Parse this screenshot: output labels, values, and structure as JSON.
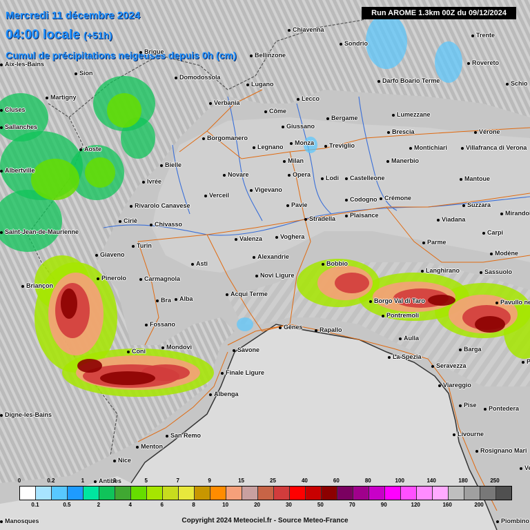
{
  "header": {
    "date_line": "Mercredi 11 décembre 2024",
    "time_line": "04:00 locale",
    "time_offset": "(+51h)",
    "product_line": "Cumul de précipitations neigeuses depuis 0h (cm)"
  },
  "run_label": "Run AROME 1.3km 00Z du 09/12/2024",
  "copyright": "Copyright 2024 Meteociel.fr - Source Meteo-France",
  "colors": {
    "sea": "#d6d6d6",
    "land": "#c4c4c4",
    "roads": "#e06a10",
    "rivers": "#3a6fd8",
    "borders": "#444444",
    "header_text": "#1e90ff"
  },
  "legend": {
    "top_labels": [
      "0",
      "0.2",
      "1",
      "3",
      "5",
      "7",
      "9",
      "15",
      "25",
      "40",
      "60",
      "80",
      "100",
      "140",
      "180",
      "250"
    ],
    "bottom_labels": [
      "0.1",
      "0.5",
      "2",
      "4",
      "6",
      "8",
      "10",
      "20",
      "30",
      "50",
      "70",
      "90",
      "120",
      "160",
      "200"
    ],
    "colors": [
      "#ffffff",
      "#a8e4ff",
      "#58c8ff",
      "#1e9bff",
      "#00e6a0",
      "#10c45a",
      "#40a832",
      "#66dd00",
      "#a6e600",
      "#c8dc1e",
      "#e8e83c",
      "#c89600",
      "#ff8c00",
      "#f5a07a",
      "#c8a0a0",
      "#c86446",
      "#d23c3c",
      "#ff0000",
      "#c80000",
      "#8c0000",
      "#7a0060",
      "#a0008c",
      "#c800c8",
      "#ff00ff",
      "#ff50ff",
      "#ff8cff",
      "#ffaaff",
      "#bebebe",
      "#a0a0a0",
      "#787878",
      "#505050"
    ]
  },
  "cities": [
    {
      "name": "Chiavenna"
    },
    {
      "name": "Sondrio"
    },
    {
      "name": "Trente"
    },
    {
      "name": "Brigue"
    },
    {
      "name": "Bellinzone"
    },
    {
      "name": "Rovereto"
    },
    {
      "name": "Sion"
    },
    {
      "name": "Domodossola"
    },
    {
      "name": "Lugano"
    },
    {
      "name": "Darfo Boario Terme"
    },
    {
      "name": "Schio"
    },
    {
      "name": "Martigny"
    },
    {
      "name": "Verbania"
    },
    {
      "name": "Côme"
    },
    {
      "name": "Lecco"
    },
    {
      "name": "Lumezzane"
    },
    {
      "name": "Cluses"
    },
    {
      "name": "Bergame"
    },
    {
      "name": "Giussano"
    },
    {
      "name": "Sallanches"
    },
    {
      "name": "Brescia"
    },
    {
      "name": "Vérone"
    },
    {
      "name": "Borgomanero"
    },
    {
      "name": "Legnano"
    },
    {
      "name": "Monza"
    },
    {
      "name": "Treviglio"
    },
    {
      "name": "Montichiari"
    },
    {
      "name": "Villafranca di Verona"
    },
    {
      "name": "Aoste"
    },
    {
      "name": "Milan"
    },
    {
      "name": "Manerbio"
    },
    {
      "name": "Bielle"
    },
    {
      "name": "Novare"
    },
    {
      "name": "Opera"
    },
    {
      "name": "Lodi"
    },
    {
      "name": "Castelleone"
    },
    {
      "name": "Mantoue"
    },
    {
      "name": "Ivrée"
    },
    {
      "name": "Vigevano"
    },
    {
      "name": "Crémone"
    },
    {
      "name": "Verceil"
    },
    {
      "name": "Codogno"
    },
    {
      "name": "Rivarolo Canavese"
    },
    {
      "name": "Pavie"
    },
    {
      "name": "Suzzara"
    },
    {
      "name": "Plaisance"
    },
    {
      "name": "Mirandola"
    },
    {
      "name": "Ciriè"
    },
    {
      "name": "Stradella"
    },
    {
      "name": "Chivasso"
    },
    {
      "name": "Viadana"
    },
    {
      "name": "Saint-Jean-de-Maurienne"
    },
    {
      "name": "Carpi"
    },
    {
      "name": "Voghera"
    },
    {
      "name": "Valenza"
    },
    {
      "name": "Turin"
    },
    {
      "name": "Parme"
    },
    {
      "name": "Giaveno"
    },
    {
      "name": "Alexandrie"
    },
    {
      "name": "Modène"
    },
    {
      "name": "Asti"
    },
    {
      "name": "Bobbio"
    },
    {
      "name": "Langhirano"
    },
    {
      "name": "Sassuolo"
    },
    {
      "name": "Novi Ligure"
    },
    {
      "name": "Pinerolo"
    },
    {
      "name": "Carmagnola"
    },
    {
      "name": "Briançon"
    },
    {
      "name": "Acqui Terme"
    },
    {
      "name": "Borgo Val di Taro"
    },
    {
      "name": "Pavullo nel"
    },
    {
      "name": "Bra"
    },
    {
      "name": "Alba"
    },
    {
      "name": "Pontremoli"
    },
    {
      "name": "Fossano"
    },
    {
      "name": "Gênes"
    },
    {
      "name": "Rapallo"
    },
    {
      "name": "Aulla"
    },
    {
      "name": "Coni"
    },
    {
      "name": "Mondovì"
    },
    {
      "name": "Savone"
    },
    {
      "name": "Barga"
    },
    {
      "name": "La Spezia"
    },
    {
      "name": "Pisto"
    },
    {
      "name": "Finale Ligure"
    },
    {
      "name": "Seravezza"
    },
    {
      "name": "Viareggio"
    },
    {
      "name": "Albenga"
    },
    {
      "name": "Pise"
    },
    {
      "name": "Pontedera"
    },
    {
      "name": "Digne-les-Bains"
    },
    {
      "name": "Livourne"
    },
    {
      "name": "San Remo"
    },
    {
      "name": "Menton"
    },
    {
      "name": "Rosignano Mari"
    },
    {
      "name": "Nice"
    },
    {
      "name": "Antibes"
    },
    {
      "name": "Venturi"
    },
    {
      "name": "Manosques"
    },
    {
      "name": "Piombino"
    },
    {
      "name": "Aix-les-Bains"
    },
    {
      "name": "Albertville"
    }
  ]
}
